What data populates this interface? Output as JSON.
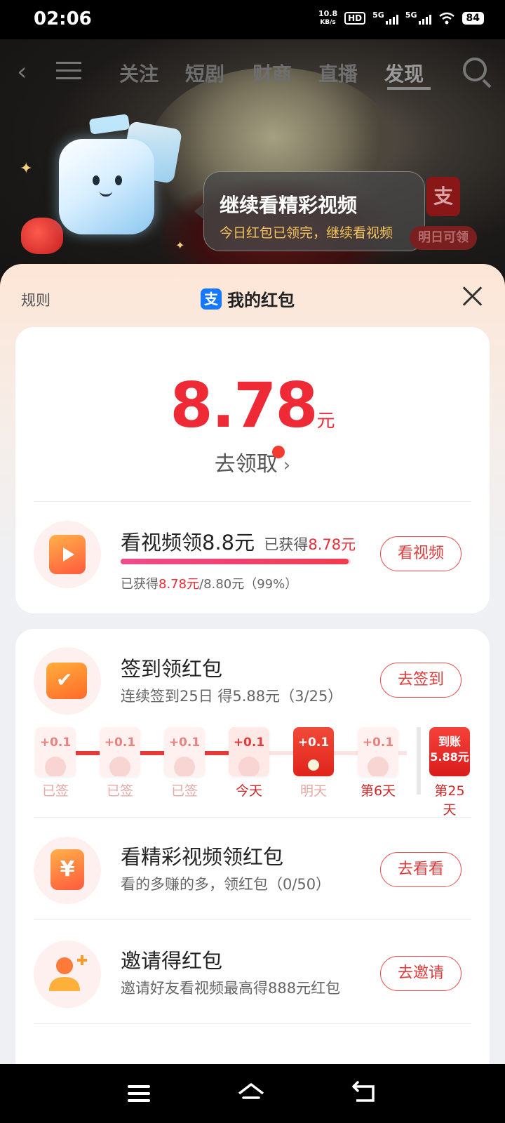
{
  "status_bar": {
    "time": "02:06",
    "net_speed": "10.8",
    "net_speed_unit": "KB/s",
    "hd_label": "HD",
    "sim1": "5G",
    "sim2": "5G",
    "battery": "84"
  },
  "top_nav": {
    "tabs": [
      "关注",
      "短剧",
      "财商",
      "直播",
      "发现"
    ],
    "active_tab": "发现"
  },
  "promo": {
    "bubble_title": "继续看精彩视频",
    "bubble_subtitle": "今日红包已领完，继续看视频",
    "side_icon_char": "支",
    "side_label": "明日可领"
  },
  "sheet": {
    "rules_label": "规则",
    "title": "我的红包",
    "alipay_char": "支"
  },
  "balance": {
    "amount": "8.78",
    "unit": "元",
    "claim_label": "去领取"
  },
  "video_task": {
    "title": "看视频领8.8元",
    "earned_prefix": "已获得",
    "earned_value": "8.78元",
    "progress_prefix": "已获得",
    "progress_value": "8.78元",
    "progress_suffix": "/8.80元（99%）",
    "progress_fraction": 0.99,
    "button": "看视频"
  },
  "checkin": {
    "title": "签到领红包",
    "subtitle": "连续签到25日 得5.88元（3/25）",
    "button": "去签到",
    "days": [
      {
        "reward": "+0.1",
        "label": "已签",
        "state": "done"
      },
      {
        "reward": "+0.1",
        "label": "已签",
        "state": "done"
      },
      {
        "reward": "+0.1",
        "label": "已签",
        "state": "done"
      },
      {
        "reward": "+0.1",
        "label": "今天",
        "state": "today"
      },
      {
        "reward": "+0.1",
        "label": "明天",
        "state": "tomorrow"
      },
      {
        "reward": "+0.1",
        "label": "第6天",
        "state": "future"
      }
    ],
    "final_day": {
      "line1": "到账",
      "line2": "5.88元",
      "label": "第25天"
    }
  },
  "watch_task": {
    "title": "看精彩视频领红包",
    "subtitle": "看的多赚的多，领红包（0/50）",
    "button": "去看看"
  },
  "invite_task": {
    "title": "邀请得红包",
    "subtitle": "邀请好友看视频最高得888元红包",
    "button": "去邀请"
  }
}
